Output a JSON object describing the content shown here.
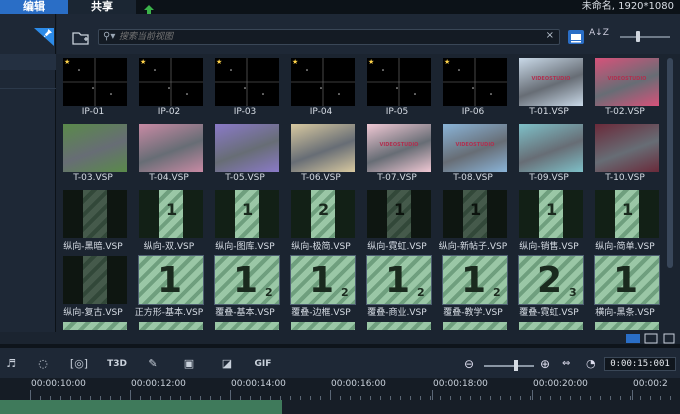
{
  "tabs": {
    "edit": "编辑",
    "share": "共享"
  },
  "project_title": "未命名, 1920*1080",
  "search": {
    "placeholder": "搜索当前视图",
    "clear": "×"
  },
  "icons": {
    "upload": "upload-arrow-icon",
    "pin": "pin-icon",
    "folder": "folder-icon",
    "search": "search-icon",
    "view": "view-mode-icon",
    "sort": "sort-az-icon"
  },
  "sort_label": "A↓Z",
  "items": [
    {
      "label": "IP-01",
      "type": "ip",
      "star": true
    },
    {
      "label": "IP-02",
      "type": "ip",
      "star": true
    },
    {
      "label": "IP-03",
      "type": "ip",
      "star": true
    },
    {
      "label": "IP-04",
      "type": "ip",
      "star": true
    },
    {
      "label": "IP-05",
      "type": "ip",
      "star": true
    },
    {
      "label": "IP-06",
      "type": "ip",
      "star": true
    },
    {
      "label": "T-01.VSP",
      "type": "photo",
      "color": "#c9d9e8",
      "caption": "VIDEOSTUDIO"
    },
    {
      "label": "T-02.VSP",
      "type": "photo",
      "color": "#d7527a",
      "caption": "VIDEOSTUDIO"
    },
    {
      "label": "T-03.VSP",
      "type": "photo",
      "color": "#5a8a4a"
    },
    {
      "label": "T-04.VSP",
      "type": "photo",
      "color": "#c88aa4"
    },
    {
      "label": "T-05.VSP",
      "type": "photo",
      "color": "#8a7ac8"
    },
    {
      "label": "T-06.VSP",
      "type": "photo",
      "color": "#d8c9a0"
    },
    {
      "label": "T-07.VSP",
      "type": "photo",
      "color": "#f0c8d4",
      "caption": "VIDEOSTUDIO"
    },
    {
      "label": "T-08.VSP",
      "type": "photo",
      "color": "#8ab4d8",
      "caption": "VIDEOSTUDIO"
    },
    {
      "label": "T-09.VSP",
      "type": "photo",
      "color": "#7ec0c8"
    },
    {
      "label": "T-10.VSP",
      "type": "photo",
      "color": "#6a2a3a"
    },
    {
      "label": "纵向-黑暗.VSP",
      "type": "portrait",
      "dark": true
    },
    {
      "label": "纵向-双.VSP",
      "type": "portrait",
      "digits": "1 2"
    },
    {
      "label": "纵向-图库.VSP",
      "type": "portrait",
      "digits": "1 2"
    },
    {
      "label": "纵向-极简.VSP",
      "type": "portrait",
      "digits": "2"
    },
    {
      "label": "纵向-霓虹.VSP",
      "type": "portrait",
      "digits": "1",
      "dark": true
    },
    {
      "label": "纵向-新帖子.VSP",
      "type": "portrait",
      "digits": "1 2",
      "dark": true
    },
    {
      "label": "纵向-销售.VSP",
      "type": "portrait",
      "digits": "1"
    },
    {
      "label": "纵向-简单.VSP",
      "type": "portrait",
      "digits": "1"
    },
    {
      "label": "纵向-复古.VSP",
      "type": "portrait",
      "dark": true
    },
    {
      "label": "正方形-基本.VSP",
      "type": "big",
      "digits": "1"
    },
    {
      "label": "覆叠-基本.VSP",
      "type": "big",
      "digits": "1 2"
    },
    {
      "label": "覆叠-边框.VSP",
      "type": "big",
      "digits": "1 2"
    },
    {
      "label": "覆叠-商业.VSP",
      "type": "big",
      "digits": "1 2"
    },
    {
      "label": "覆叠-教学.VSP",
      "type": "big",
      "digits": "1 2"
    },
    {
      "label": "覆叠-霓虹.VSP",
      "type": "big",
      "digits": "2 3"
    },
    {
      "label": "横向-黑条.VSP",
      "type": "big",
      "digits": "1"
    },
    {
      "label": "",
      "type": "partial"
    },
    {
      "label": "",
      "type": "partial"
    },
    {
      "label": "",
      "type": "partial"
    },
    {
      "label": "",
      "type": "partial"
    },
    {
      "label": "",
      "type": "partial"
    },
    {
      "label": "",
      "type": "partial"
    },
    {
      "label": "",
      "type": "partial"
    },
    {
      "label": "",
      "type": "partial"
    }
  ],
  "timeline": {
    "tools": [
      "auto-music-icon",
      "motion-track-icon",
      "subtitle-icon",
      "title-3d-icon",
      "mask-icon",
      "multicam-icon",
      "split-screen-icon",
      "gif-icon"
    ],
    "tool_glyphs": [
      "♬",
      "◌",
      "[◎]",
      "T3D",
      "✎",
      "▣",
      "◪",
      "GIF"
    ],
    "timecode": "0:00:15:001",
    "ruler_labels": [
      "00:00:10:00",
      "00:00:12:00",
      "00:00:14:00",
      "00:00:16:00",
      "00:00:18:00",
      "00:00:20:00",
      "00:00:2"
    ]
  }
}
